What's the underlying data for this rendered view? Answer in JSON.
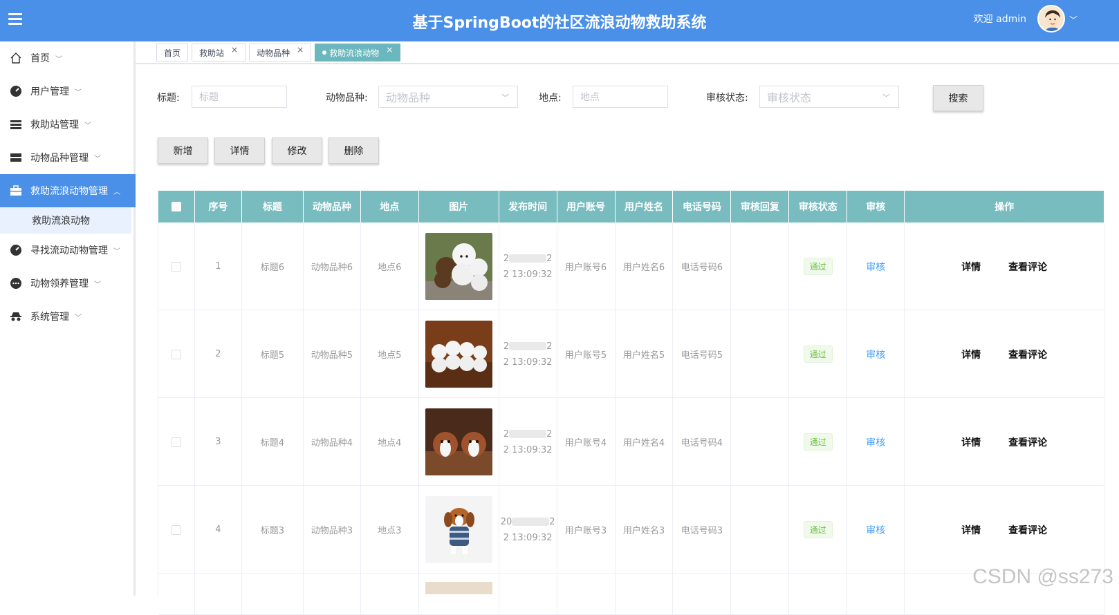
{
  "header": {
    "title": "基于SpringBoot的社区流浪动物救助系统",
    "welcome": "欢迎 admin"
  },
  "sidebar": {
    "items": [
      {
        "label": "首页",
        "icon": "home-icon"
      },
      {
        "label": "用户管理",
        "icon": "gauge-icon"
      },
      {
        "label": "救助站管理",
        "icon": "list-icon"
      },
      {
        "label": "动物品种管理",
        "icon": "list-icon"
      },
      {
        "label": "救助流浪动物管理",
        "icon": "briefcase-icon"
      },
      {
        "label": "寻找流动动物管理",
        "icon": "gauge-icon"
      },
      {
        "label": "动物领养管理",
        "icon": "chat-icon"
      },
      {
        "label": "系统管理",
        "icon": "incognito-icon"
      }
    ],
    "submenu": "救助流浪动物"
  },
  "tabs": [
    {
      "label": "首页"
    },
    {
      "label": "救助站"
    },
    {
      "label": "动物品种"
    },
    {
      "label": "救助流浪动物",
      "active": true
    }
  ],
  "search": {
    "title_label": "标题:",
    "title_placeholder": "标题",
    "breed_label": "动物品种:",
    "breed_placeholder": "动物品种",
    "location_label": "地点:",
    "location_placeholder": "地点",
    "status_label": "审核状态:",
    "status_placeholder": "审核状态",
    "search_button": "搜索"
  },
  "toolbar": {
    "add": "新增",
    "detail": "详情",
    "edit": "修改",
    "delete": "删除"
  },
  "table": {
    "headers": [
      "序号",
      "标题",
      "动物品种",
      "地点",
      "图片",
      "发布时间",
      "用户账号",
      "用户姓名",
      "电话号码",
      "审核回复",
      "审核状态",
      "审核",
      "操作"
    ],
    "rows": [
      {
        "no": "1",
        "title": "标题6",
        "breed": "动物品种6",
        "location": "地点6",
        "time_a": "2",
        "time_b": "2",
        "time2": "2 13:09:32",
        "account": "用户账号6",
        "name": "用户姓名6",
        "phone": "电话号码6",
        "reply": "",
        "status": "通过",
        "audit": "审核",
        "detail": "详情",
        "comment": "查看评论"
      },
      {
        "no": "2",
        "title": "标题5",
        "breed": "动物品种5",
        "location": "地点5",
        "time_a": "2",
        "time_b": "2",
        "time2": "2 13:09:32",
        "account": "用户账号5",
        "name": "用户姓名5",
        "phone": "电话号码5",
        "reply": "",
        "status": "通过",
        "audit": "审核",
        "detail": "详情",
        "comment": "查看评论"
      },
      {
        "no": "3",
        "title": "标题4",
        "breed": "动物品种4",
        "location": "地点4",
        "time_a": "2",
        "time_b": "2",
        "time2": "2 13:09:32",
        "account": "用户账号4",
        "name": "用户姓名4",
        "phone": "电话号码4",
        "reply": "",
        "status": "通过",
        "audit": "审核",
        "detail": "详情",
        "comment": "查看评论"
      },
      {
        "no": "4",
        "title": "标题3",
        "breed": "动物品种3",
        "location": "地点3",
        "time_a": "20",
        "time_b": "2",
        "time2": "2 13:09:32",
        "account": "用户账号3",
        "name": "用户姓名3",
        "phone": "电话号码3",
        "reply": "",
        "status": "通过",
        "audit": "审核",
        "detail": "详情",
        "comment": "查看评论"
      }
    ]
  },
  "watermark": "CSDN @ss273",
  "colors": {
    "header": "#4a90e8",
    "table_header": "#78bcc0",
    "active_tab": "#6ab7bd"
  }
}
